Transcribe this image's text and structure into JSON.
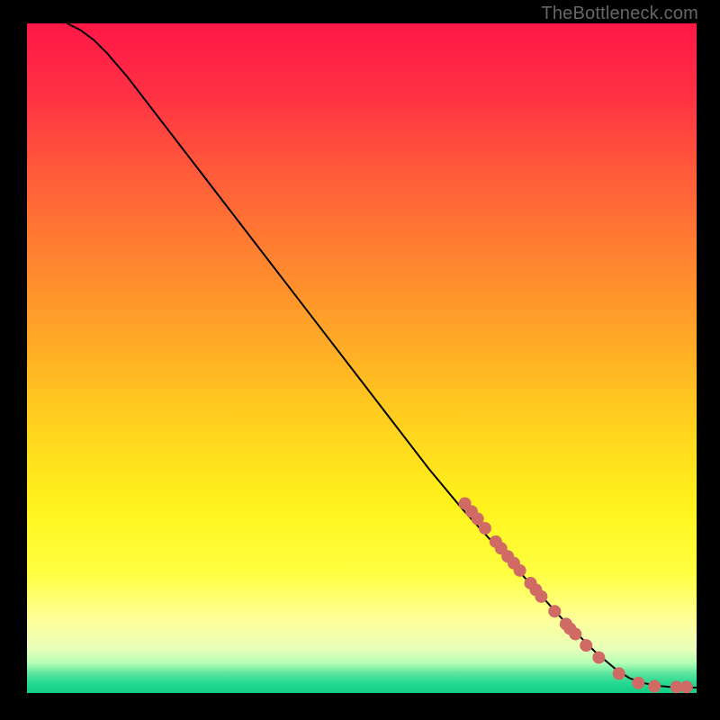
{
  "branding": {
    "text": "TheBottleneck.com"
  },
  "colors": {
    "dot_fill": "#cf6a65",
    "curve_stroke": "#000000",
    "gradient_stops": [
      {
        "offset": 0.0,
        "color": "#ff1846"
      },
      {
        "offset": 0.1,
        "color": "#ff2f44"
      },
      {
        "offset": 0.22,
        "color": "#ff5a3a"
      },
      {
        "offset": 0.35,
        "color": "#ff8330"
      },
      {
        "offset": 0.48,
        "color": "#ffab26"
      },
      {
        "offset": 0.6,
        "color": "#ffd21e"
      },
      {
        "offset": 0.72,
        "color": "#fff31c"
      },
      {
        "offset": 0.82,
        "color": "#ffff40"
      },
      {
        "offset": 0.89,
        "color": "#ffff9a"
      },
      {
        "offset": 0.935,
        "color": "#e8ffba"
      },
      {
        "offset": 0.955,
        "color": "#b5ffb5"
      },
      {
        "offset": 0.97,
        "color": "#5fe6a0"
      },
      {
        "offset": 0.985,
        "color": "#25d990"
      },
      {
        "offset": 1.0,
        "color": "#15cc85"
      }
    ]
  },
  "chart_data": {
    "type": "line",
    "title": "",
    "xlabel": "",
    "ylabel": "",
    "xlim": [
      0,
      100
    ],
    "ylim": [
      0,
      100
    ],
    "grid": false,
    "legend": false,
    "series": [
      {
        "name": "bottleneck-curve",
        "x": [
          6,
          8,
          10,
          12,
          15,
          20,
          25,
          30,
          35,
          40,
          45,
          50,
          55,
          60,
          65,
          70,
          75,
          80,
          85,
          88,
          90,
          92,
          94,
          96,
          98,
          100
        ],
        "y": [
          100,
          99,
          97.5,
          95.5,
          92,
          85.5,
          79,
          72.5,
          66,
          59.5,
          53,
          46.5,
          40,
          33.5,
          27.5,
          22,
          16.5,
          11,
          6,
          3.5,
          2.2,
          1.5,
          1.1,
          0.9,
          0.8,
          0.8
        ]
      }
    ],
    "dots": [
      {
        "x": 65.4,
        "y": 28.3
      },
      {
        "x": 66.4,
        "y": 27.1
      },
      {
        "x": 67.3,
        "y": 26.0
      },
      {
        "x": 68.4,
        "y": 24.6
      },
      {
        "x": 70.0,
        "y": 22.6
      },
      {
        "x": 70.8,
        "y": 21.6
      },
      {
        "x": 71.8,
        "y": 20.4
      },
      {
        "x": 72.7,
        "y": 19.4
      },
      {
        "x": 73.6,
        "y": 18.3
      },
      {
        "x": 75.2,
        "y": 16.4
      },
      {
        "x": 76.0,
        "y": 15.4
      },
      {
        "x": 76.8,
        "y": 14.4
      },
      {
        "x": 78.8,
        "y": 12.2
      },
      {
        "x": 80.5,
        "y": 10.3
      },
      {
        "x": 81.1,
        "y": 9.6
      },
      {
        "x": 81.9,
        "y": 8.8
      },
      {
        "x": 83.5,
        "y": 7.1
      },
      {
        "x": 85.4,
        "y": 5.3
      },
      {
        "x": 88.4,
        "y": 2.9
      },
      {
        "x": 91.3,
        "y": 1.5
      },
      {
        "x": 93.7,
        "y": 1.0
      },
      {
        "x": 97.0,
        "y": 0.9
      },
      {
        "x": 98.5,
        "y": 0.9
      }
    ],
    "dot_radius_px": 7
  }
}
